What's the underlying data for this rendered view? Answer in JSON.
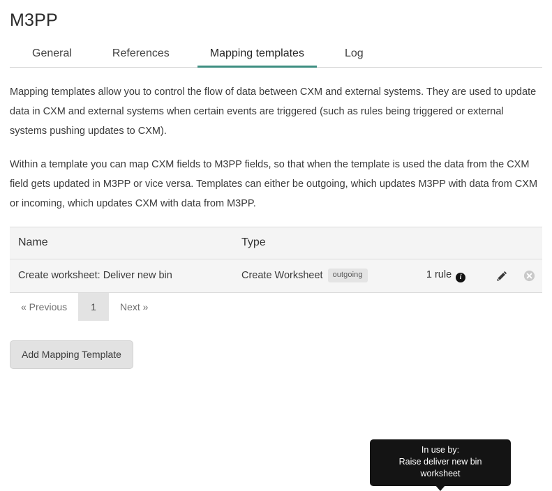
{
  "header": {
    "title": "M3PP"
  },
  "tabs": [
    {
      "label": "General",
      "active": false
    },
    {
      "label": "References",
      "active": false
    },
    {
      "label": "Mapping templates",
      "active": true
    },
    {
      "label": "Log",
      "active": false
    }
  ],
  "intro": {
    "paragraph_1": "Mapping templates allow you to control the flow of data between CXM and external systems. They are used to update data in CXM and external systems when certain events are triggered (such as rules being triggered or external systems pushing updates to CXM).",
    "paragraph_2": "Within a template you can map CXM fields to M3PP fields, so that when the template is used the data from the CXM field gets updated in M3PP or vice versa. Templates can either be outgoing, which updates M3PP with data from CXM or incoming, which updates CXM with data from M3PP."
  },
  "table": {
    "columns": {
      "name": "Name",
      "type": "Type",
      "rules": "",
      "actions": ""
    },
    "rows": [
      {
        "name": "Create worksheet: Deliver new bin",
        "type": "Create Worksheet",
        "direction_badge": "outgoing",
        "rules": "1 rule",
        "info_icon": "info-icon",
        "edit_icon": "pencil-icon",
        "delete_icon": "remove-circle-icon"
      }
    ]
  },
  "tooltip": {
    "line_1": "In use by:",
    "line_2": "Raise deliver new bin",
    "line_3": "worksheet"
  },
  "pagination": {
    "previous": "« Previous",
    "current_page": "1",
    "next": "Next »"
  },
  "actions": {
    "add_mapping_template": "Add Mapping Template"
  },
  "colors": {
    "accent_tab_underline": "#3e8e81",
    "table_header_bg": "#f4f4f4",
    "row_bg": "#f5f5f5",
    "tooltip_bg": "#141414",
    "badge_bg": "#e4e4e4",
    "button_bg": "#e2e2e2"
  }
}
